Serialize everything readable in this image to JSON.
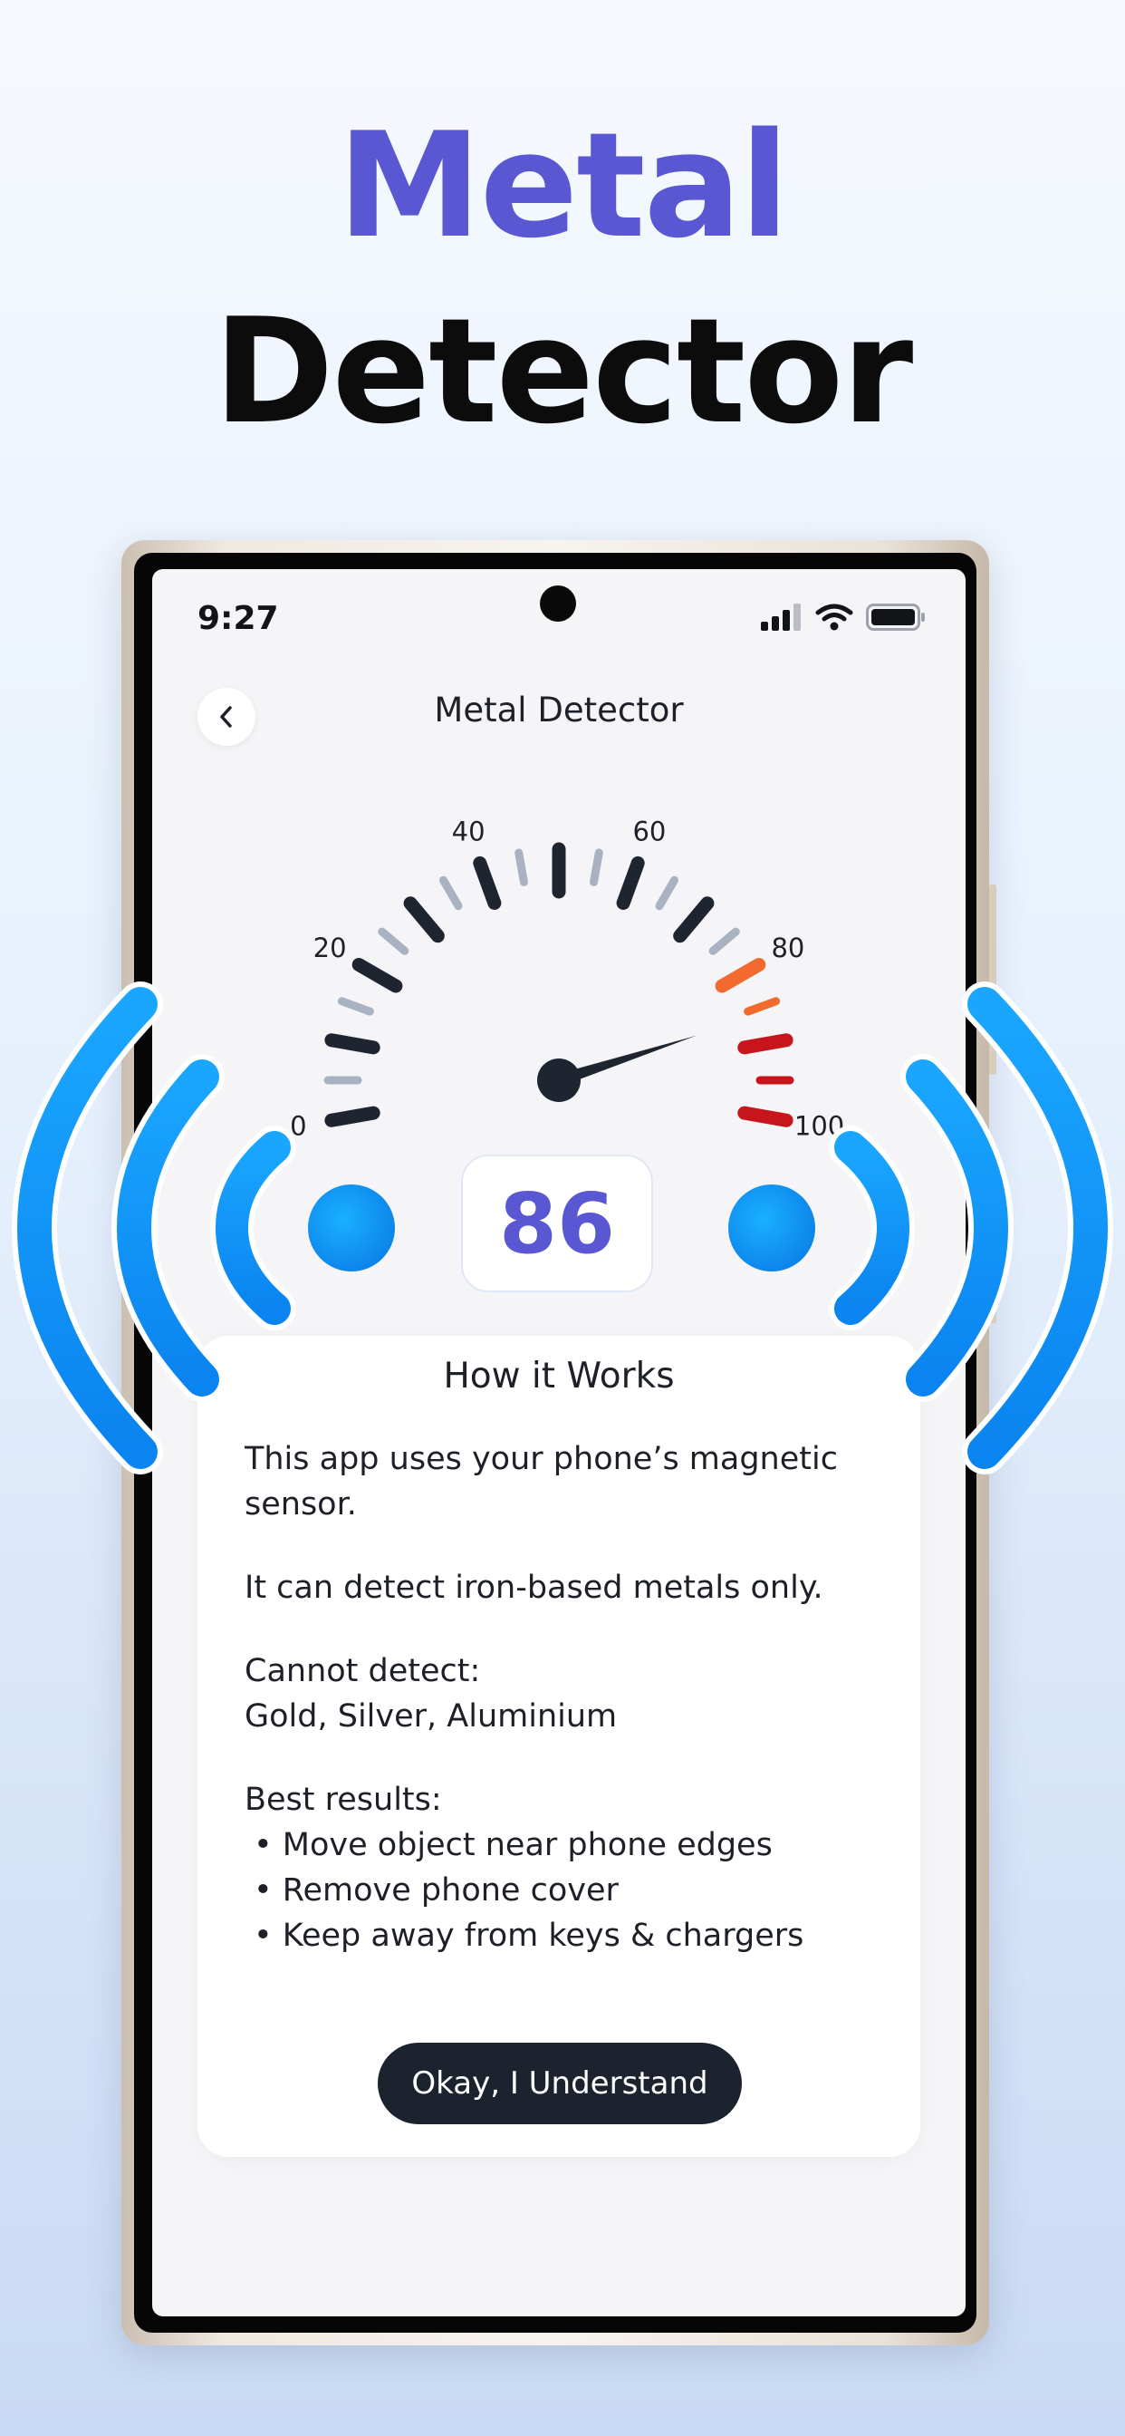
{
  "hero": {
    "line1": "Metal",
    "line2": "Detector"
  },
  "status_bar": {
    "time": "9:27",
    "icons": [
      "signal-icon",
      "wifi-icon",
      "battery-icon"
    ]
  },
  "nav": {
    "title": "Metal Detector",
    "back_icon": "chevron-left-icon"
  },
  "gauge": {
    "min": 0,
    "max": 100,
    "value": 86,
    "labels": [
      "0",
      "20",
      "40",
      "60",
      "80",
      "100"
    ],
    "colors": {
      "normal": "#1e2430",
      "minor": "#a9b2c0",
      "warning": "#f26a2e",
      "danger": "#c8151c"
    }
  },
  "reading": "86",
  "how_it_works": {
    "title": "How it Works",
    "intro": "This app uses your phone’s magnetic sensor.",
    "detect": "It can detect iron-based metals only.",
    "cannot_label": "Cannot detect:",
    "cannot_list": "Gold, Silver, Aluminium",
    "best_label": "Best results:",
    "tips": [
      "• Move object near phone edges",
      "• Remove phone cover",
      "• Keep away from keys & chargers"
    ],
    "button": "Okay, I Understand"
  },
  "colors": {
    "accent": "#5a57d3",
    "wave_blue": "#0d8cf5",
    "button_dark": "#1d232e"
  }
}
